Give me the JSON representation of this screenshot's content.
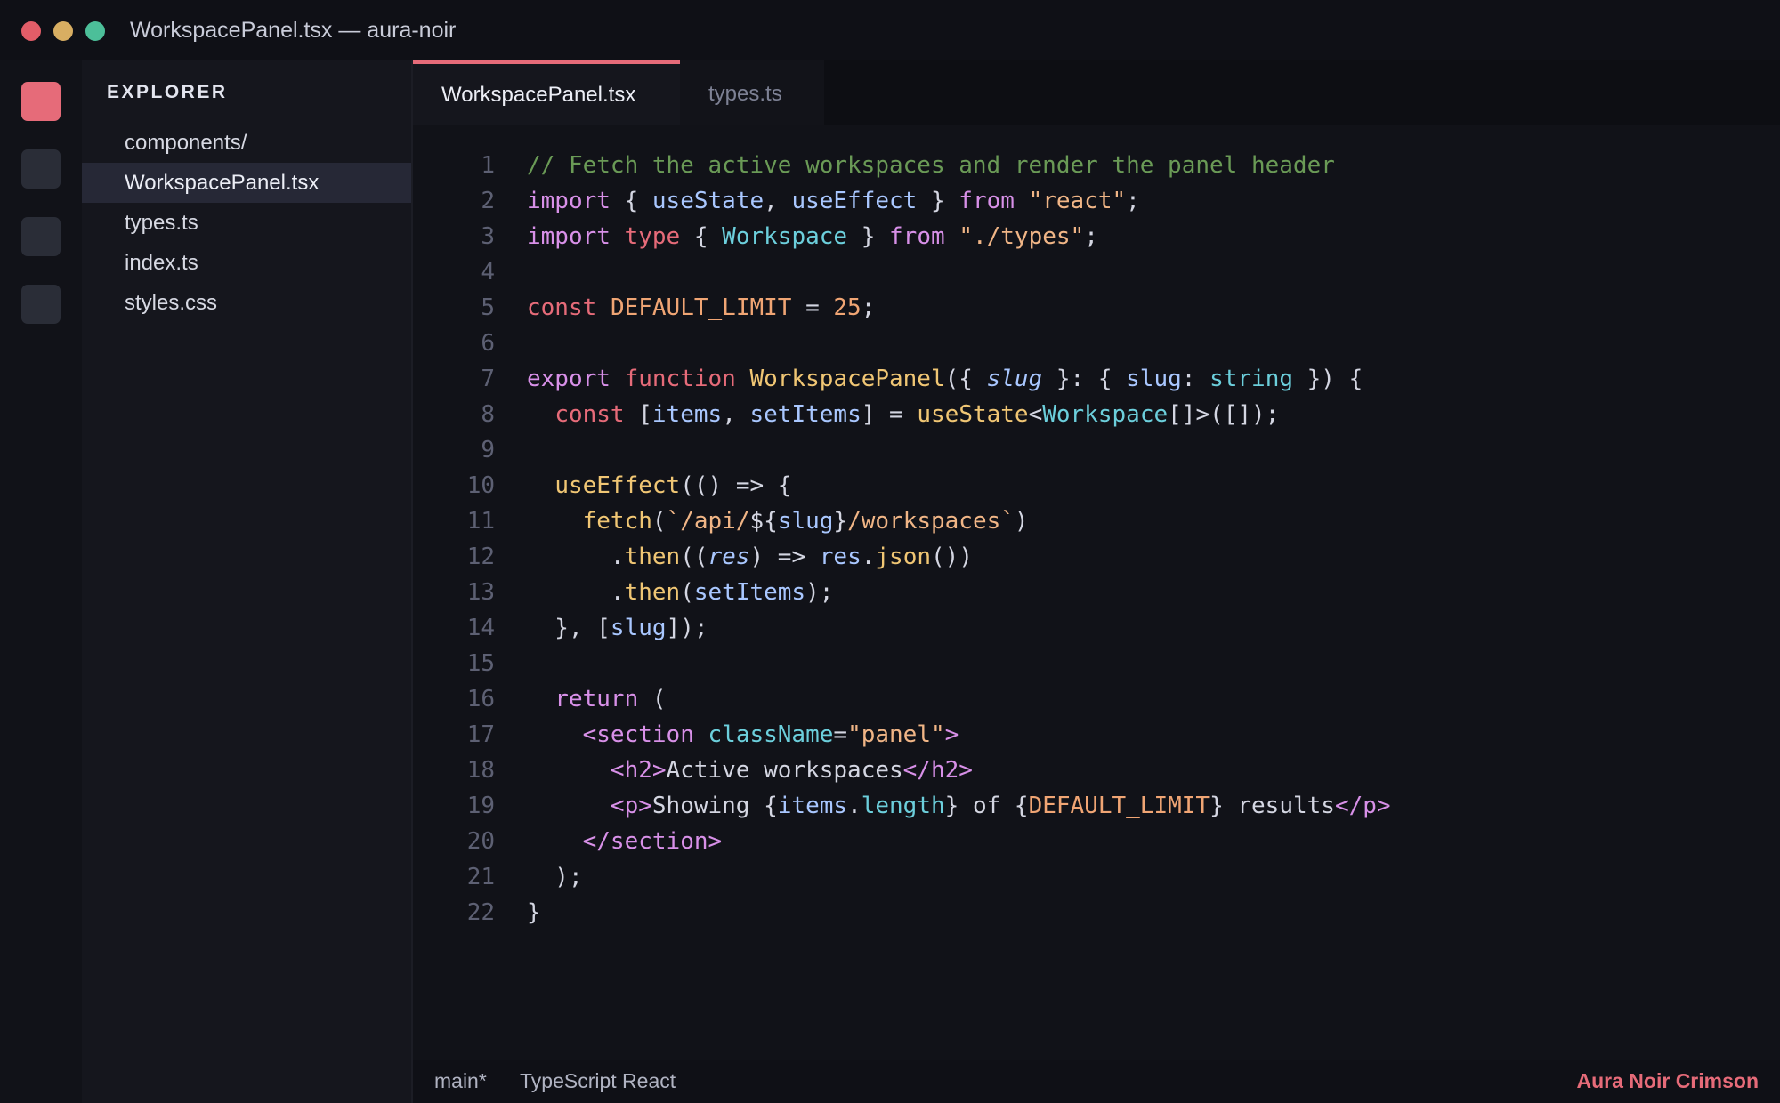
{
  "window": {
    "title": "WorkspacePanel.tsx — aura-noir"
  },
  "sidebar": {
    "title": "EXPLORER",
    "files": [
      "components/",
      "WorkspacePanel.tsx",
      "types.ts",
      "index.ts",
      "styles.css"
    ],
    "selected": "WorkspacePanel.tsx"
  },
  "tabs": [
    {
      "label": "WorkspacePanel.tsx",
      "active": true
    },
    {
      "label": "types.ts",
      "active": false
    }
  ],
  "code": {
    "line_numbers": [
      "1",
      "2",
      "3",
      "4",
      "5",
      "6",
      "7",
      "8",
      "9",
      "10",
      "11",
      "12",
      "13",
      "14",
      "15",
      "16",
      "17",
      "18",
      "19",
      "20",
      "21",
      "22"
    ],
    "lines": [
      [
        [
          "comment",
          "// Fetch the active workspaces and render the panel header"
        ]
      ],
      [
        [
          "keyword",
          "import"
        ],
        [
          "plain",
          " { "
        ],
        [
          "ident",
          "useState"
        ],
        [
          "plain",
          ", "
        ],
        [
          "ident",
          "useEffect"
        ],
        [
          "plain",
          " } "
        ],
        [
          "keyword",
          "from"
        ],
        [
          "plain",
          " "
        ],
        [
          "string",
          "\"react\""
        ],
        [
          "plain",
          ";"
        ]
      ],
      [
        [
          "keyword",
          "import"
        ],
        [
          "plain",
          " "
        ],
        [
          "const",
          "type"
        ],
        [
          "plain",
          " { "
        ],
        [
          "type",
          "Workspace"
        ],
        [
          "plain",
          " } "
        ],
        [
          "keyword",
          "from"
        ],
        [
          "plain",
          " "
        ],
        [
          "string",
          "\"./types\""
        ],
        [
          "plain",
          ";"
        ]
      ],
      [],
      [
        [
          "const",
          "const"
        ],
        [
          "plain",
          " "
        ],
        [
          "number",
          "DEFAULT_LIMIT"
        ],
        [
          "plain",
          " = "
        ],
        [
          "number",
          "25"
        ],
        [
          "plain",
          ";"
        ]
      ],
      [],
      [
        [
          "keyword",
          "export"
        ],
        [
          "plain",
          " "
        ],
        [
          "const",
          "function"
        ],
        [
          "plain",
          " "
        ],
        [
          "func",
          "WorkspacePanel"
        ],
        [
          "plain",
          "({ "
        ],
        [
          "param",
          "slug"
        ],
        [
          "plain",
          " }: { "
        ],
        [
          "ident",
          "slug"
        ],
        [
          "plain",
          ": "
        ],
        [
          "type",
          "string"
        ],
        [
          "plain",
          " }) {"
        ]
      ],
      [
        [
          "plain",
          "  "
        ],
        [
          "const",
          "const"
        ],
        [
          "plain",
          " ["
        ],
        [
          "ident",
          "items"
        ],
        [
          "plain",
          ", "
        ],
        [
          "ident",
          "setItems"
        ],
        [
          "plain",
          "] = "
        ],
        [
          "func",
          "useState"
        ],
        [
          "plain",
          "<"
        ],
        [
          "type",
          "Workspace"
        ],
        [
          "plain",
          "[]>([]);"
        ]
      ],
      [],
      [
        [
          "plain",
          "  "
        ],
        [
          "func",
          "useEffect"
        ],
        [
          "plain",
          "(() => {"
        ]
      ],
      [
        [
          "plain",
          "    "
        ],
        [
          "func",
          "fetch"
        ],
        [
          "plain",
          "("
        ],
        [
          "string",
          "`/api/"
        ],
        [
          "plain",
          "${"
        ],
        [
          "ident",
          "slug"
        ],
        [
          "plain",
          "}"
        ],
        [
          "string",
          "/workspaces`"
        ],
        [
          "plain",
          ")"
        ]
      ],
      [
        [
          "plain",
          "      ."
        ],
        [
          "func",
          "then"
        ],
        [
          "plain",
          "(("
        ],
        [
          "param",
          "res"
        ],
        [
          "plain",
          ") => "
        ],
        [
          "ident",
          "res"
        ],
        [
          "plain",
          "."
        ],
        [
          "func",
          "json"
        ],
        [
          "plain",
          "())"
        ]
      ],
      [
        [
          "plain",
          "      ."
        ],
        [
          "func",
          "then"
        ],
        [
          "plain",
          "("
        ],
        [
          "ident",
          "setItems"
        ],
        [
          "plain",
          ");"
        ]
      ],
      [
        [
          "plain",
          "  }, ["
        ],
        [
          "ident",
          "slug"
        ],
        [
          "plain",
          "]);"
        ]
      ],
      [],
      [
        [
          "plain",
          "  "
        ],
        [
          "keyword",
          "return"
        ],
        [
          "plain",
          " ("
        ]
      ],
      [
        [
          "plain",
          "    "
        ],
        [
          "tag",
          "<section"
        ],
        [
          "plain",
          " "
        ],
        [
          "attr",
          "className"
        ],
        [
          "plain",
          "="
        ],
        [
          "string",
          "\"panel\""
        ],
        [
          "tag",
          ">"
        ]
      ],
      [
        [
          "plain",
          "      "
        ],
        [
          "tag",
          "<h2>"
        ],
        [
          "plain",
          "Active workspaces"
        ],
        [
          "tag",
          "</h2>"
        ]
      ],
      [
        [
          "plain",
          "      "
        ],
        [
          "tag",
          "<p>"
        ],
        [
          "plain",
          "Showing {"
        ],
        [
          "ident",
          "items"
        ],
        [
          "plain",
          "."
        ],
        [
          "attr",
          "length"
        ],
        [
          "plain",
          "} of {"
        ],
        [
          "number",
          "DEFAULT_LIMIT"
        ],
        [
          "plain",
          "} results"
        ],
        [
          "tag",
          "</p>"
        ]
      ],
      [
        [
          "plain",
          "    "
        ],
        [
          "tag",
          "</section>"
        ]
      ],
      [
        [
          "plain",
          "  );"
        ]
      ],
      [
        [
          "plain",
          "}"
        ]
      ]
    ]
  },
  "statusbar": {
    "branch": "main*",
    "language": "TypeScript React",
    "theme": "Aura Noir Crimson"
  },
  "colors": {
    "accent": "#e66b79",
    "background": "#111218"
  }
}
